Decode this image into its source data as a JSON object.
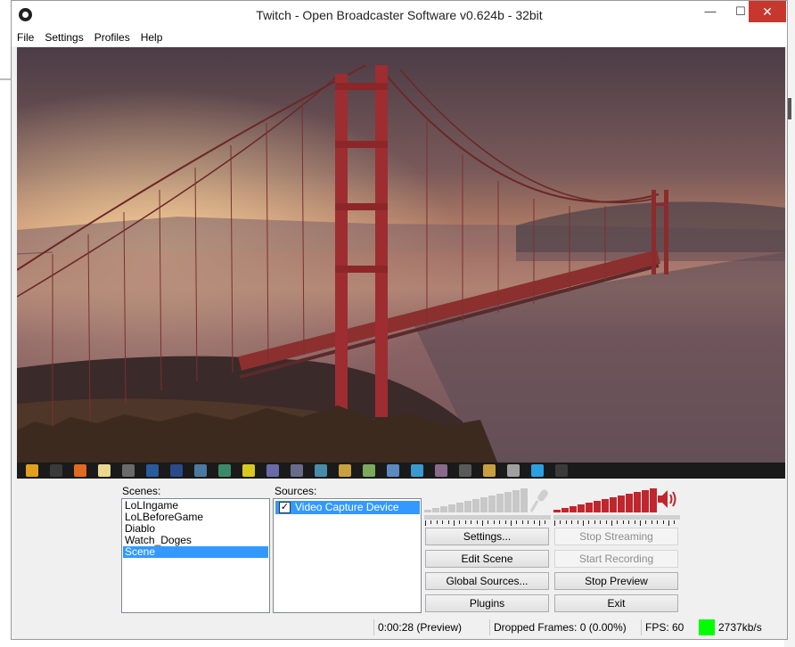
{
  "window": {
    "title": "Twitch - Open Broadcaster Software v0.624b - 32bit",
    "controls": {
      "minimize": "—",
      "maximize": "☐",
      "close": "✕"
    }
  },
  "menu": [
    "File",
    "Settings",
    "Profiles",
    "Help"
  ],
  "taskbar_icons": [
    "chrome-icon",
    "obs-icon",
    "firefox-icon",
    "folder-icon",
    "lightroom-icon",
    "photoshop-icon",
    "league-icon",
    "app-icon",
    "app-icon",
    "skull-icon",
    "wow-icon",
    "app-icon",
    "app-icon",
    "app-icon",
    "app-icon",
    "app-icon",
    "app-icon",
    "app-icon",
    "app-icon",
    "app-icon",
    "app-icon",
    "skype-icon",
    "obs-icon"
  ],
  "scenes": {
    "label": "Scenes:",
    "items": [
      "LoLIngame",
      "LoLBeforeGame",
      "Diablo",
      "Watch_Doges",
      "Scene"
    ],
    "selected": 4
  },
  "sources": {
    "label": "Sources:",
    "items": [
      {
        "name": "Video Capture Device",
        "checked": true
      }
    ]
  },
  "audio": {
    "mic_level": 0.0,
    "desktop_level": 1.0,
    "mic_color": "#c8c8c8",
    "desktop_color": "#c0262d"
  },
  "buttons": {
    "settings": "Settings...",
    "edit_scene": "Edit Scene",
    "global_sources": "Global Sources...",
    "plugins": "Plugins",
    "stop_streaming": "Stop Streaming",
    "start_recording": "Start Recording",
    "stop_preview": "Stop Preview",
    "exit": "Exit"
  },
  "status": {
    "time": "0:00:28 (Preview)",
    "dropped_frames": "Dropped Frames: 0 (0.00%)",
    "fps": "FPS: 60",
    "bitrate": "2737kb/s",
    "indicator_color": "#00ff00"
  }
}
